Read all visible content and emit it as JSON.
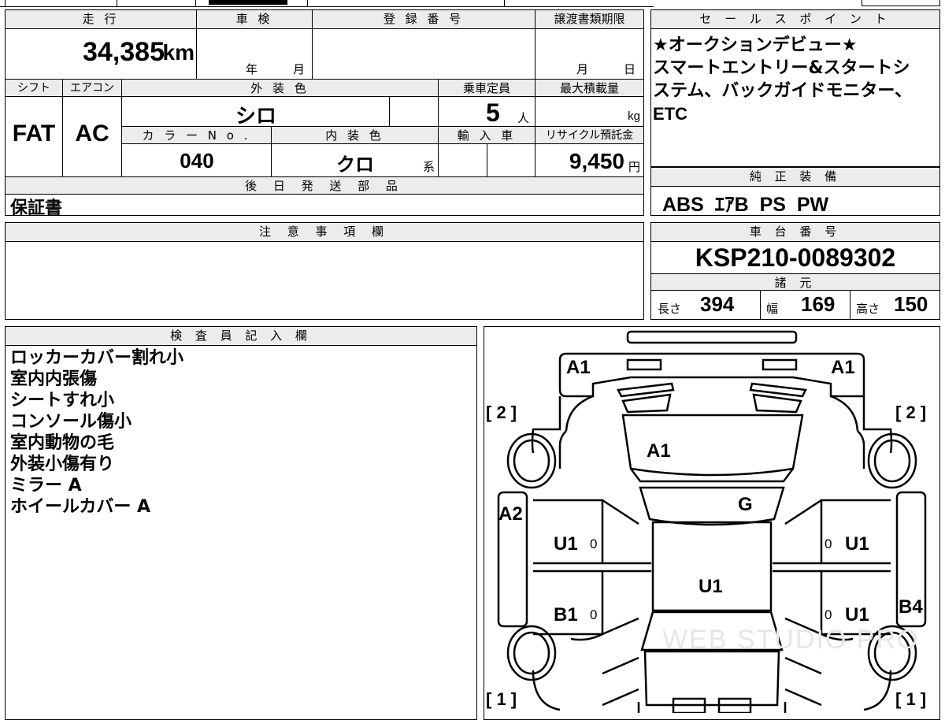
{
  "top_table": {
    "mileage_label": "走 行",
    "mileage_value": "34,385",
    "mileage_unit": "km",
    "inspection_label": "車 検",
    "inspection_year": "年",
    "inspection_month": "月",
    "registration_label": "登 録 番 号",
    "transfer_label": "譲渡書類期限",
    "transfer_month": "月",
    "transfer_day": "日",
    "shift_label": "シフト",
    "ac_label": "エアコン",
    "exterior_color_label": "外 装 色",
    "capacity_label": "乗車定員",
    "max_load_label": "最大積載量",
    "shift_value": "FAT",
    "ac_value": "AC",
    "exterior_color_value": "シロ",
    "capacity_value": "5",
    "capacity_unit": "人",
    "max_load_unit": "kg",
    "color_no_label": "カ ラ ー N o .",
    "interior_color_label": "内 装 色",
    "import_label": "輸 入 車",
    "recycle_label": "リサイクル預託金",
    "color_no_value": "040",
    "interior_color_value": "クロ",
    "interior_color_suffix": "系",
    "recycle_value": "9,450",
    "recycle_unit": "円",
    "later_parts_label": "後 日 発 送 部 品",
    "later_parts_value": "保証書"
  },
  "sales_point": {
    "label": "セ ー ル ス ポ イ ン ト",
    "lines": [
      "★オークションデビュー★",
      "スマートエントリー&スタートシ",
      "ステム、バックガイドモニター、",
      "ETC"
    ]
  },
  "equipment": {
    "label": "純 正 装 備",
    "value": "ABS  ｴｱB  PS  PW"
  },
  "notes": {
    "label": "注 意 事 項 欄"
  },
  "chassis": {
    "label": "車 台 番 号",
    "value": "KSP210-0089302",
    "specs_label": "諸 元",
    "length_label": "長さ",
    "length_value": "394",
    "width_label": "幅",
    "width_value": "169",
    "height_label": "高さ",
    "height_value": "150"
  },
  "inspector": {
    "label": "検 査 員 記 入 欄",
    "lines": [
      "ロッカーカバー割れ小",
      "室内内張傷",
      "シートすれ小",
      "コンソール傷小",
      "室内動物の毛",
      "外装小傷有り",
      "ミラー A",
      "ホイールカバー A"
    ]
  },
  "diagram": {
    "marks": {
      "front_left": "A1",
      "front_right": "A1",
      "hood": "A1",
      "windshield": "G",
      "left_fender": "A2",
      "left_front_door": "U1",
      "left_front_door_count": "0",
      "roof": "U1",
      "right_front_door": "U1",
      "right_front_door_count": "0",
      "left_rear_door": "B1",
      "left_rear_door_count": "0",
      "right_rear_door": "U1",
      "right_rear_door_count": "0",
      "right_quarter": "B4"
    },
    "bracket_top_left": "[ 2 ]",
    "bracket_top_right": "[ 2 ]",
    "bracket_bottom_left": "[ 1 ]",
    "bracket_bottom_right": "[ 1 ]",
    "watermark": "WEB STUDIO PRO"
  }
}
